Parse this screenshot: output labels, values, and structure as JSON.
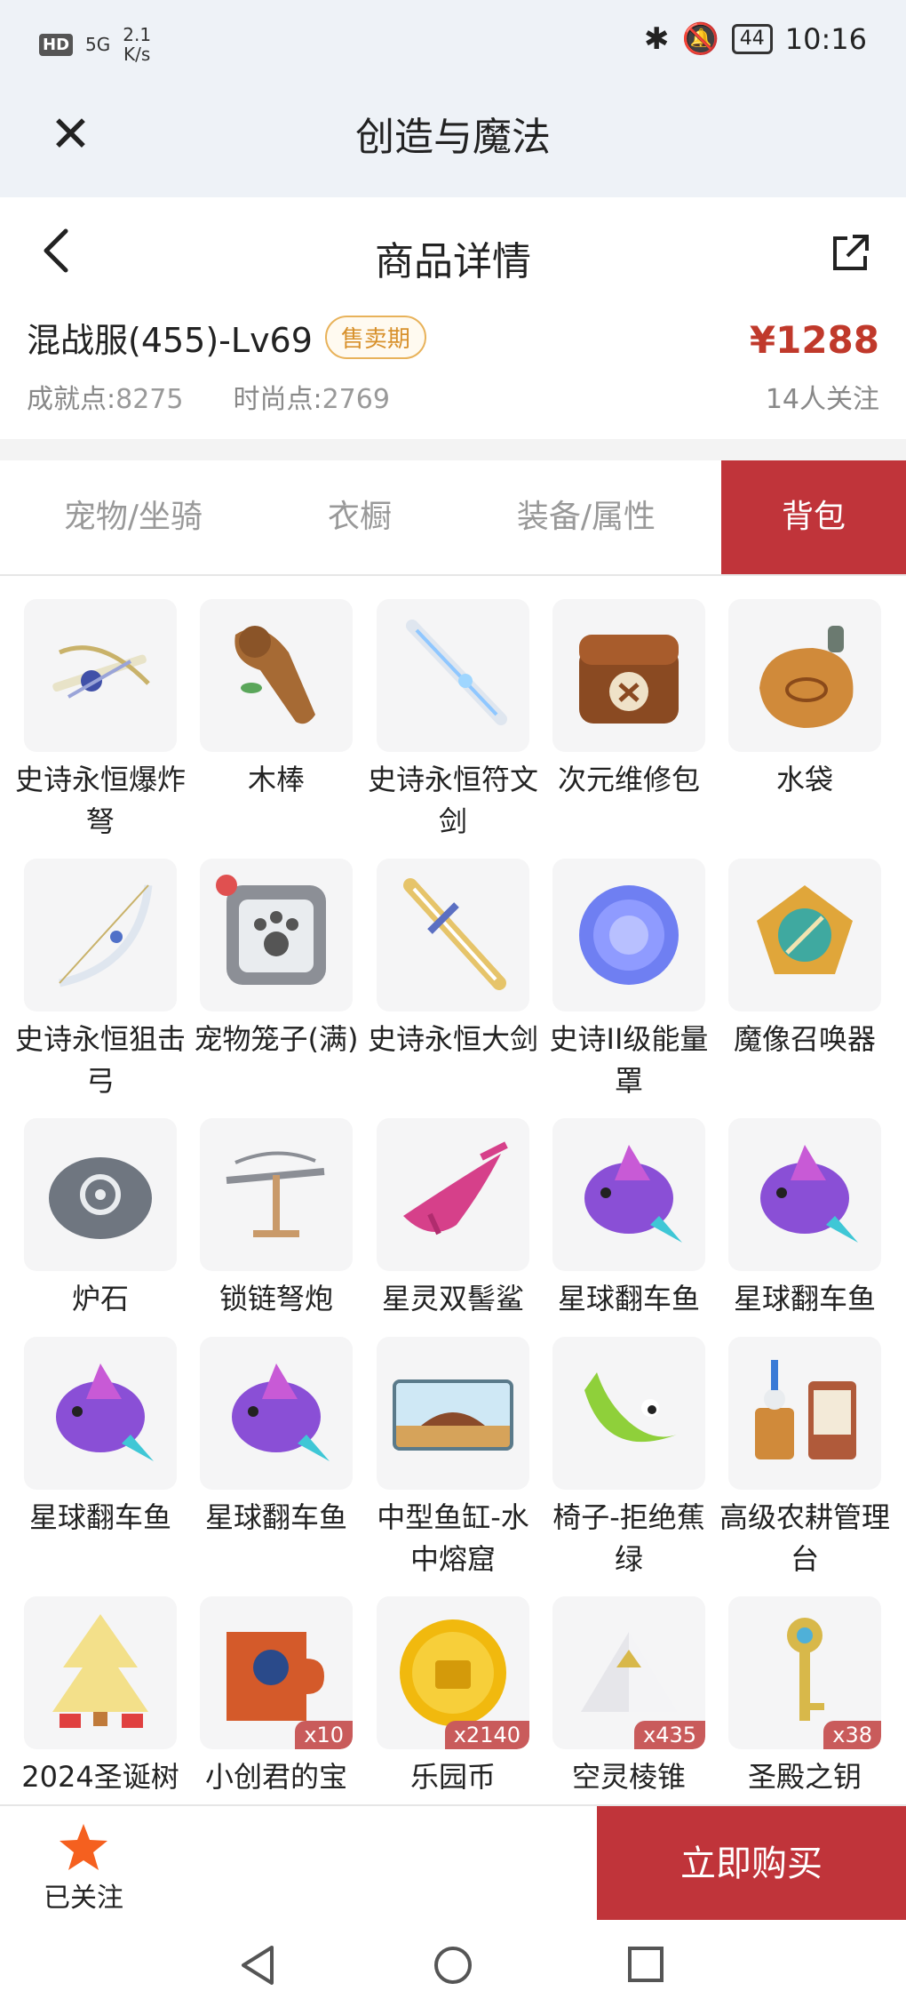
{
  "status_bar": {
    "hd": "HD",
    "network": "5G",
    "speed_value": "2.1",
    "speed_unit": "K/s",
    "battery": "44",
    "time": "10:16"
  },
  "app": {
    "title": "创造与魔法"
  },
  "nav": {
    "title": "商品详情"
  },
  "product": {
    "name": "混战服(455)-Lv69",
    "badge": "售卖期",
    "price": "¥1288",
    "achievement_label": "成就点:",
    "achievement_value": "8275",
    "fashion_label": "时尚点:",
    "fashion_value": "2769",
    "followers": "14人关注"
  },
  "tabs": [
    {
      "label": "宠物/坐骑"
    },
    {
      "label": "衣橱"
    },
    {
      "label": "装备/属性"
    },
    {
      "label": "背包"
    }
  ],
  "active_tab": "背包",
  "items": [
    {
      "label": "史诗永恒爆炸弩",
      "icon": "crossbow-icon",
      "count": ""
    },
    {
      "label": "木棒",
      "icon": "wooden-club-icon",
      "count": ""
    },
    {
      "label": "史诗永恒符文剑",
      "icon": "rune-sword-icon",
      "count": ""
    },
    {
      "label": "次元维修包",
      "icon": "repair-bag-icon",
      "count": ""
    },
    {
      "label": "水袋",
      "icon": "water-bag-icon",
      "count": ""
    },
    {
      "label": "史诗永恒狙击弓",
      "icon": "bow-icon",
      "count": ""
    },
    {
      "label": "宠物笼子(满)",
      "icon": "pet-cage-icon",
      "count": ""
    },
    {
      "label": "史诗永恒大剑",
      "icon": "greatsword-icon",
      "count": ""
    },
    {
      "label": "史诗II级能量罩",
      "icon": "energy-shield-icon",
      "count": ""
    },
    {
      "label": "魔像召唤器",
      "icon": "golem-summoner-icon",
      "count": ""
    },
    {
      "label": "炉石",
      "icon": "hearthstone-icon",
      "count": ""
    },
    {
      "label": "锁链弩炮",
      "icon": "chain-ballista-icon",
      "count": ""
    },
    {
      "label": "星灵双髻鲨",
      "icon": "hammerhead-shark-icon",
      "count": ""
    },
    {
      "label": "星球翻车鱼",
      "icon": "sunfish-icon",
      "count": ""
    },
    {
      "label": "星球翻车鱼",
      "icon": "sunfish-icon",
      "count": ""
    },
    {
      "label": "星球翻车鱼",
      "icon": "sunfish-icon",
      "count": ""
    },
    {
      "label": "星球翻车鱼",
      "icon": "sunfish-icon",
      "count": ""
    },
    {
      "label": "中型鱼缸-水中熔窟",
      "icon": "fish-tank-icon",
      "count": ""
    },
    {
      "label": "椅子-拒绝蕉绿",
      "icon": "banana-chair-icon",
      "count": ""
    },
    {
      "label": "高级农耕管理台",
      "icon": "farm-console-icon",
      "count": ""
    },
    {
      "label": "2024圣诞树",
      "icon": "christmas-tree-icon",
      "count": ""
    },
    {
      "label": "小创君的宝",
      "icon": "puzzle-icon",
      "count": "x10"
    },
    {
      "label": "乐园币",
      "icon": "coin-icon",
      "count": "x2140"
    },
    {
      "label": "空灵棱锥",
      "icon": "pyramid-icon",
      "count": "x435"
    },
    {
      "label": "圣殿之钥",
      "icon": "key-icon",
      "count": "x38"
    }
  ],
  "bottom": {
    "follow_label": "已关注",
    "buy_label": "立即购买"
  },
  "colors": {
    "accent": "#c0343a",
    "price": "#c0392b",
    "badge": "#d8912c",
    "star": "#f5601f"
  }
}
